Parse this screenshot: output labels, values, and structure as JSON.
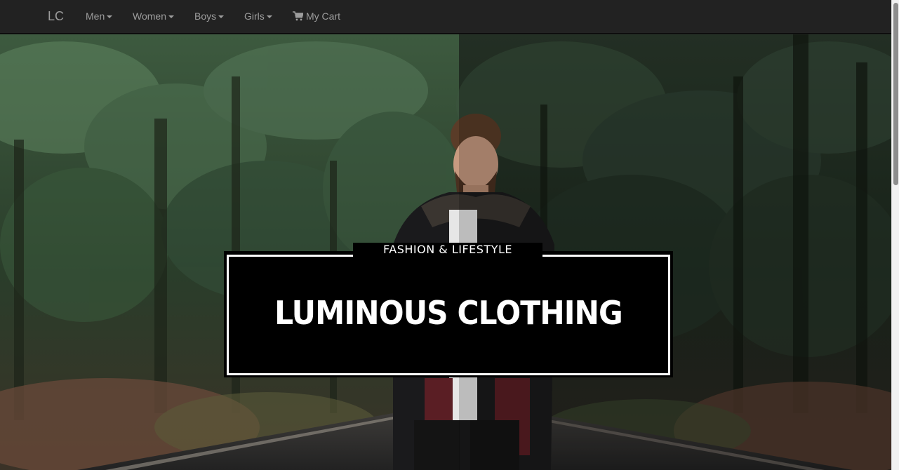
{
  "navbar": {
    "brand": "LC",
    "items": [
      {
        "label": "Men",
        "dropdown": true
      },
      {
        "label": "Women",
        "dropdown": true
      },
      {
        "label": "Boys",
        "dropdown": true
      },
      {
        "label": "Girls",
        "dropdown": true
      }
    ],
    "cart": {
      "label": "My Cart",
      "icon": "cart-icon"
    }
  },
  "hero": {
    "tagline": "FASHION & LIFESTYLE",
    "title": "LUMINOUS CLOTHING"
  },
  "colors": {
    "navbar_bg": "#222222",
    "nav_text": "#9d9d9d",
    "title_bg": "#000000",
    "title_text": "#ffffff"
  }
}
